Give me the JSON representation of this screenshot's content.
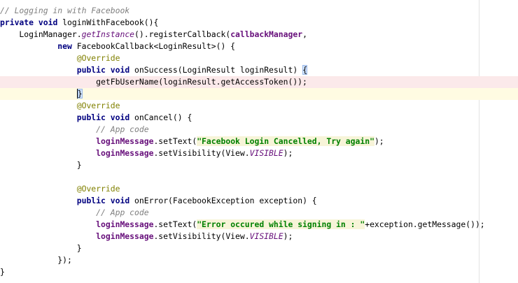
{
  "editor": {
    "lines": [
      {
        "state": "",
        "tokens": [
          {
            "t": "// Logging in with Facebook",
            "c": "cm"
          }
        ]
      },
      {
        "state": "",
        "tokens": [
          {
            "t": "private",
            "c": "kw"
          },
          {
            "t": " "
          },
          {
            "t": "void",
            "c": "kw"
          },
          {
            "t": " loginWithFacebook(){"
          }
        ]
      },
      {
        "state": "",
        "tokens": [
          {
            "t": "    LoginManager."
          },
          {
            "t": "getInstance",
            "c": "st"
          },
          {
            "t": "().registerCallback("
          },
          {
            "t": "callbackManager",
            "c": "fld"
          },
          {
            "t": ","
          }
        ]
      },
      {
        "state": "",
        "tokens": [
          {
            "t": "            "
          },
          {
            "t": "new",
            "c": "kw"
          },
          {
            "t": " FacebookCallback<LoginResult>() {"
          }
        ]
      },
      {
        "state": "",
        "tokens": [
          {
            "t": "                "
          },
          {
            "t": "@Override",
            "c": "ann"
          }
        ]
      },
      {
        "state": "",
        "tokens": [
          {
            "t": "                "
          },
          {
            "t": "public",
            "c": "kw"
          },
          {
            "t": " "
          },
          {
            "t": "void",
            "c": "kw"
          },
          {
            "t": " onSuccess(LoginResult loginResult) "
          },
          {
            "t": "{",
            "c": "match"
          }
        ]
      },
      {
        "state": "error",
        "tokens": [
          {
            "t": "                    getFbUserName(loginResult.getAccessToken());"
          }
        ]
      },
      {
        "state": "caret",
        "tokens": [
          {
            "t": "                "
          },
          {
            "t": "}",
            "c": "match cursor"
          }
        ]
      },
      {
        "state": "",
        "tokens": [
          {
            "t": "                "
          },
          {
            "t": "@Override",
            "c": "ann"
          }
        ]
      },
      {
        "state": "",
        "tokens": [
          {
            "t": "                "
          },
          {
            "t": "public",
            "c": "kw"
          },
          {
            "t": " "
          },
          {
            "t": "void",
            "c": "kw"
          },
          {
            "t": " onCancel() {"
          }
        ]
      },
      {
        "state": "",
        "tokens": [
          {
            "t": "                    "
          },
          {
            "t": "// App code",
            "c": "cm"
          }
        ]
      },
      {
        "state": "",
        "tokens": [
          {
            "t": "                    "
          },
          {
            "t": "loginMessage",
            "c": "fld"
          },
          {
            "t": ".setText("
          },
          {
            "t": "\"Facebook Login Cancelled, Try again\"",
            "c": "str"
          },
          {
            "t": ");"
          }
        ]
      },
      {
        "state": "",
        "tokens": [
          {
            "t": "                    "
          },
          {
            "t": "loginMessage",
            "c": "fld"
          },
          {
            "t": ".setVisibility(View."
          },
          {
            "t": "VISIBLE",
            "c": "st"
          },
          {
            "t": ");"
          }
        ]
      },
      {
        "state": "",
        "tokens": [
          {
            "t": "                }"
          }
        ]
      },
      {
        "state": "",
        "tokens": [
          {
            "t": ""
          }
        ]
      },
      {
        "state": "",
        "tokens": [
          {
            "t": "                "
          },
          {
            "t": "@Override",
            "c": "ann"
          }
        ]
      },
      {
        "state": "",
        "tokens": [
          {
            "t": "                "
          },
          {
            "t": "public",
            "c": "kw"
          },
          {
            "t": " "
          },
          {
            "t": "void",
            "c": "kw"
          },
          {
            "t": " onError(FacebookException exception) {"
          }
        ]
      },
      {
        "state": "",
        "tokens": [
          {
            "t": "                    "
          },
          {
            "t": "// App code",
            "c": "cm"
          }
        ]
      },
      {
        "state": "",
        "tokens": [
          {
            "t": "                    "
          },
          {
            "t": "loginMessage",
            "c": "fld"
          },
          {
            "t": ".setText("
          },
          {
            "t": "\"Error occured while signing in : \"",
            "c": "str"
          },
          {
            "t": "+exception.getMessage());"
          }
        ]
      },
      {
        "state": "",
        "tokens": [
          {
            "t": "                    "
          },
          {
            "t": "loginMessage",
            "c": "fld"
          },
          {
            "t": ".setVisibility(View."
          },
          {
            "t": "VISIBLE",
            "c": "st"
          },
          {
            "t": ");"
          }
        ]
      },
      {
        "state": "",
        "tokens": [
          {
            "t": "                }"
          }
        ]
      },
      {
        "state": "",
        "tokens": [
          {
            "t": "            });"
          }
        ]
      },
      {
        "state": "",
        "tokens": [
          {
            "t": "}"
          }
        ]
      }
    ]
  }
}
